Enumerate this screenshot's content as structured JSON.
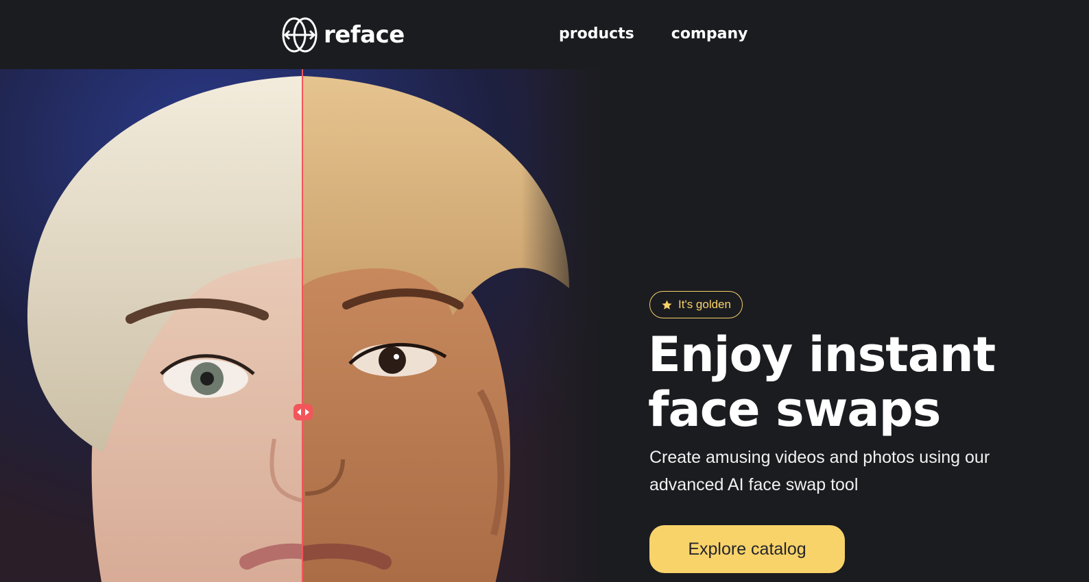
{
  "header": {
    "logo_text": "reface",
    "nav": [
      {
        "label": "products"
      },
      {
        "label": "company"
      }
    ]
  },
  "hero": {
    "badge": {
      "icon": "star-icon",
      "label": "It's golden"
    },
    "headline_line1": "Enjoy instant",
    "headline_line2": "face swaps",
    "subtitle": "Create amusing videos and photos using our advanced AI face swap tool",
    "cta_label": "Explore catalog",
    "comparison": {
      "left": "original-face",
      "right": "swapped-face",
      "handle_icon": "drag-arrows-icon"
    }
  },
  "colors": {
    "background": "#1b1c20",
    "accent": "#f8d36a",
    "divider": "#f2555a",
    "text": "#ffffff"
  }
}
